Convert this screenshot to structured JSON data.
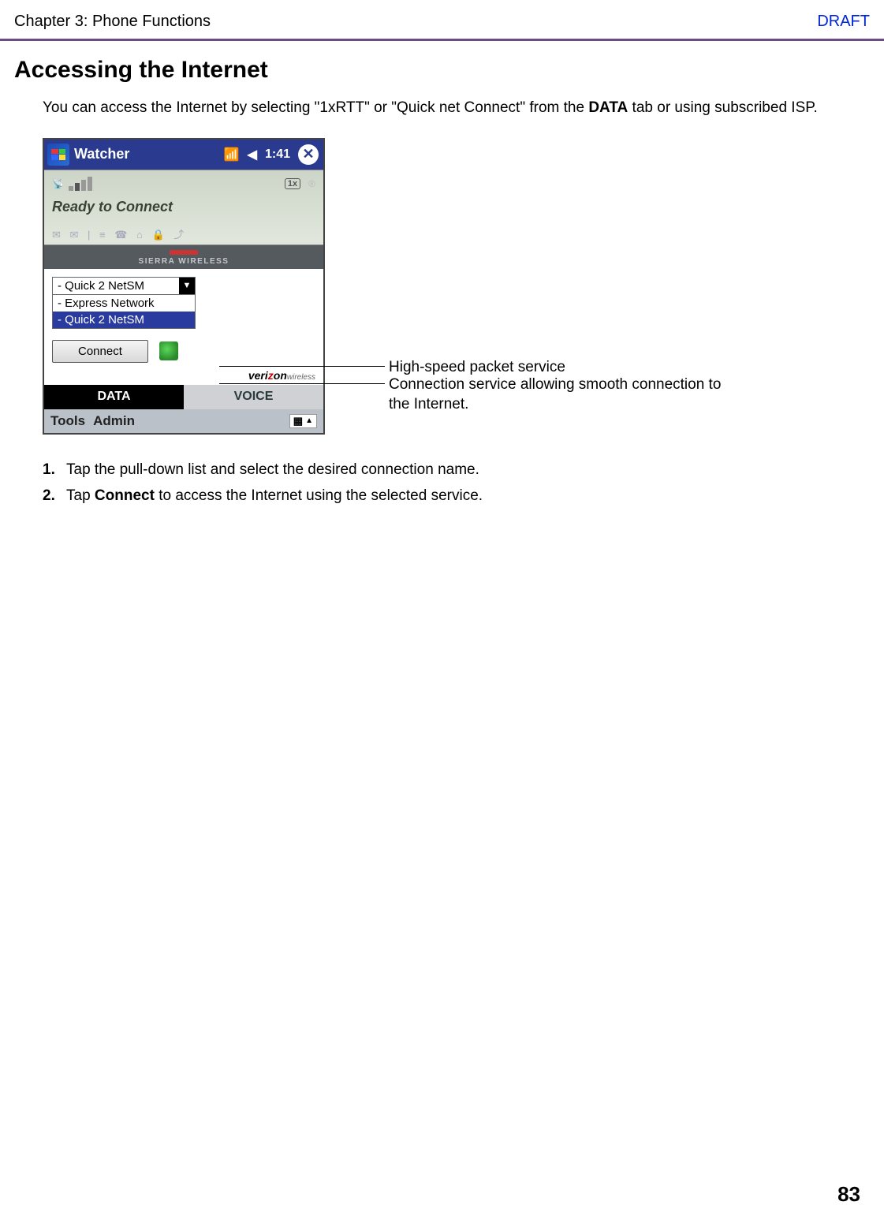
{
  "header": {
    "chapter": "Chapter 3: Phone Functions",
    "draft": "DRAFT"
  },
  "section": {
    "heading": "Accessing the Internet",
    "intro_pre": "You can access the Internet by selecting \"1xRTT\" or \"Quick net Connect\" from the ",
    "intro_bold": "DATA",
    "intro_post": " tab or using subscribed ISP."
  },
  "screenshot": {
    "title_app": "Watcher",
    "title_time": "1:41",
    "status_text": "Ready to Connect",
    "onex_label": "1x",
    "sierra_label": "SIERRA WIRELESS",
    "dropdown_selected": "- Quick 2 NetSM",
    "dropdown_items": [
      "- Express Network",
      "- Quick 2 NetSM"
    ],
    "connect_label": "Connect",
    "carrier_main": "veri",
    "carrier_z": "z",
    "carrier_on": "on",
    "carrier_sub": "wireless",
    "tabs": {
      "data": "DATA",
      "voice": "VOICE"
    },
    "bottom_menu": {
      "tools": "Tools",
      "admin": "Admin"
    }
  },
  "callouts": {
    "express": "High-speed packet service",
    "quick": "Connection service allowing smooth connection to the Internet."
  },
  "steps": {
    "s1": {
      "num": "1.",
      "text": "Tap the pull-down list and select the desired connection name."
    },
    "s2": {
      "num": "2.",
      "pre": "Tap ",
      "bold": "Connect",
      "post": " to access the Internet using the selected service."
    }
  },
  "page_number": "83"
}
